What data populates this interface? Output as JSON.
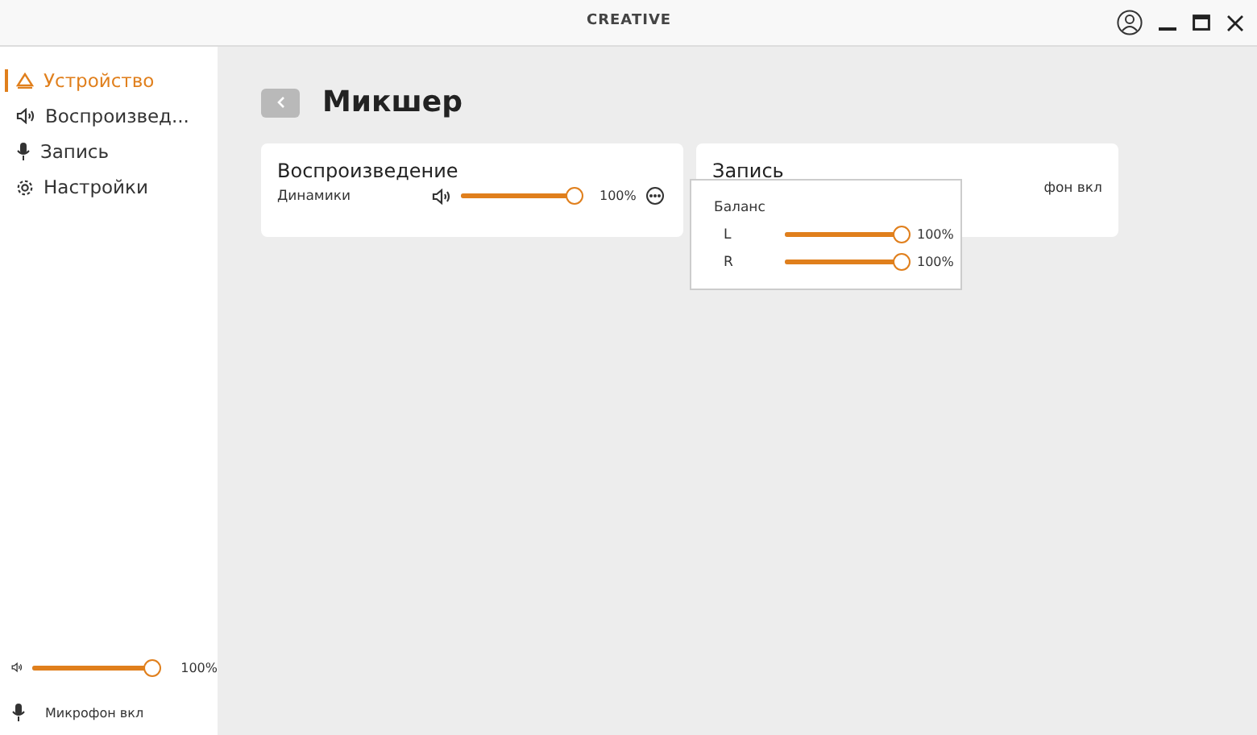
{
  "window": {
    "logo": "CREATIVE"
  },
  "sidebar": {
    "items": [
      {
        "label": "Устройство",
        "selected": true
      },
      {
        "label": "Воспроизвед...",
        "selected": false
      },
      {
        "label": "Запись",
        "selected": false
      },
      {
        "label": "Настройки",
        "selected": false
      }
    ],
    "volume": {
      "level": 1,
      "reading": "100%"
    },
    "mic_status": "Микрофон вкл"
  },
  "page": {
    "title": "Микшер"
  },
  "cards": [
    {
      "title": "Воспроизведение",
      "row": {
        "label": "Динамики",
        "level": 1,
        "reading": "100%"
      }
    },
    {
      "title": "Запись",
      "row_fragment": "фон вкл"
    }
  ],
  "balance_popover": {
    "title": "Баланс",
    "channels": [
      {
        "label": "L",
        "level": 1,
        "reading": "100%"
      },
      {
        "label": "R",
        "level": 1,
        "reading": "100%"
      }
    ]
  }
}
